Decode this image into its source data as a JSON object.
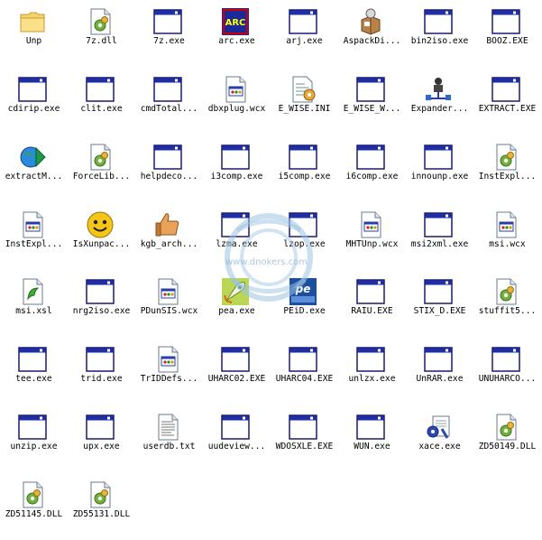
{
  "watermark": {
    "text": "www.dnokers.com"
  },
  "files": [
    {
      "name": "Unp",
      "icon": "folder-icon"
    },
    {
      "name": "7z.dll",
      "icon": "dll-gear-icon"
    },
    {
      "name": "7z.exe",
      "icon": "exe-window-icon"
    },
    {
      "name": "arc.exe",
      "icon": "arc-app-icon"
    },
    {
      "name": "arj.exe",
      "icon": "exe-window-icon"
    },
    {
      "name": "AspackDi...",
      "icon": "aspack-box-icon"
    },
    {
      "name": "bin2iso.exe",
      "icon": "exe-window-icon"
    },
    {
      "name": "BOOZ.EXE",
      "icon": "exe-window-icon"
    },
    {
      "name": "cdirip.exe",
      "icon": "exe-window-icon"
    },
    {
      "name": "clit.exe",
      "icon": "exe-window-icon"
    },
    {
      "name": "cmdTotal...",
      "icon": "exe-window-icon"
    },
    {
      "name": "dbxplug.wcx",
      "icon": "wcx-file-icon"
    },
    {
      "name": "E_WISE.INI",
      "icon": "ini-gear-icon"
    },
    {
      "name": "E_WISE_W...",
      "icon": "exe-window-icon"
    },
    {
      "name": "Expander...",
      "icon": "expander-network-icon"
    },
    {
      "name": "EXTRACT.EXE",
      "icon": "exe-window-icon"
    },
    {
      "name": "extractM...",
      "icon": "globe-arrow-icon"
    },
    {
      "name": "ForceLib...",
      "icon": "dll-gear-icon"
    },
    {
      "name": "helpdeco...",
      "icon": "exe-window-icon"
    },
    {
      "name": "i3comp.exe",
      "icon": "exe-window-icon"
    },
    {
      "name": "i5comp.exe",
      "icon": "exe-window-icon"
    },
    {
      "name": "i6comp.exe",
      "icon": "exe-window-icon"
    },
    {
      "name": "innounp.exe",
      "icon": "exe-window-icon"
    },
    {
      "name": "InstExpl...",
      "icon": "dll-gear-icon"
    },
    {
      "name": "InstExpl...",
      "icon": "wcx-file-icon"
    },
    {
      "name": "IsXunpac...",
      "icon": "smiley-icon"
    },
    {
      "name": "kgb_arch...",
      "icon": "thumbs-up-icon"
    },
    {
      "name": "lzma.exe",
      "icon": "exe-window-icon"
    },
    {
      "name": "lzop.exe",
      "icon": "exe-window-icon"
    },
    {
      "name": "MHTUnp.wcx",
      "icon": "wcx-file-icon"
    },
    {
      "name": "msi2xml.exe",
      "icon": "exe-window-icon"
    },
    {
      "name": "msi.wcx",
      "icon": "wcx-file-icon"
    },
    {
      "name": "msi.xsl",
      "icon": "xsl-file-icon"
    },
    {
      "name": "nrg2iso.exe",
      "icon": "exe-window-icon"
    },
    {
      "name": "PDunSIS.wcx",
      "icon": "wcx-file-icon"
    },
    {
      "name": "pea.exe",
      "icon": "pea-rocket-icon"
    },
    {
      "name": "PEiD.exe",
      "icon": "peid-icon"
    },
    {
      "name": "RAIU.EXE",
      "icon": "exe-window-icon"
    },
    {
      "name": "STIX_D.EXE",
      "icon": "exe-window-icon"
    },
    {
      "name": "stuffit5...",
      "icon": "dll-gear-icon"
    },
    {
      "name": "tee.exe",
      "icon": "exe-window-icon"
    },
    {
      "name": "trid.exe",
      "icon": "exe-window-icon"
    },
    {
      "name": "TrIDDefs...",
      "icon": "wcx-file-icon"
    },
    {
      "name": "UHARC02.EXE",
      "icon": "exe-window-icon"
    },
    {
      "name": "UHARC04.EXE",
      "icon": "exe-window-icon"
    },
    {
      "name": "unlzx.exe",
      "icon": "exe-window-icon"
    },
    {
      "name": "UnRAR.exe",
      "icon": "exe-window-icon"
    },
    {
      "name": "UNUHARCO...",
      "icon": "exe-window-icon"
    },
    {
      "name": "unzip.exe",
      "icon": "exe-window-icon"
    },
    {
      "name": "upx.exe",
      "icon": "exe-window-icon"
    },
    {
      "name": "userdb.txt",
      "icon": "txt-file-icon"
    },
    {
      "name": "uudeview...",
      "icon": "exe-window-icon"
    },
    {
      "name": "WDOSXLE.EXE",
      "icon": "exe-window-icon"
    },
    {
      "name": "WUN.exe",
      "icon": "exe-window-icon"
    },
    {
      "name": "xace.exe",
      "icon": "xace-gear-icon"
    },
    {
      "name": "ZD50149.DLL",
      "icon": "dll-gear-icon"
    },
    {
      "name": "ZD51145.DLL",
      "icon": "dll-gear-icon"
    },
    {
      "name": "ZD55131.DLL",
      "icon": "dll-gear-icon"
    }
  ]
}
